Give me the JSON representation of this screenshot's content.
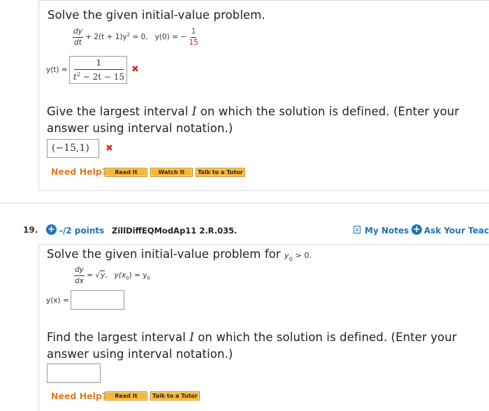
{
  "q18": {
    "title": "Solve the given initial-value problem.",
    "eq_dy": "dy",
    "eq_dt": "dt",
    "eq_rest": "+ 2(t + 1)y",
    "eq_sup": "2",
    "eq_zero": "= 0,",
    "eq_ic": "y(0) = −",
    "ic_num": "1",
    "ic_den": "15",
    "answer_label": "y(t) =",
    "answer_num": "1",
    "answer_den_t": "t",
    "answer_den_sup": "2",
    "answer_den_rest": "− 2t − 15",
    "interval_prompt": "Give the largest interval I on which the solution is defined. (Enter your answer using interval notation.)",
    "interval_prompt_pre": "Give the largest interval ",
    "interval_prompt_I": "I",
    "interval_prompt_post": " on which the solution is defined. (Enter your answer using interval notation.)",
    "interval_answer": "(−15,1)",
    "need_help": "Need Help?",
    "btn_read": "Read It",
    "btn_watch": "Watch It",
    "btn_tutor": "Talk to a Tutor"
  },
  "q19": {
    "number": "19.",
    "points": "-/2 points",
    "code": "ZillDiffEQModAp11 2.R.035.",
    "my_notes": "My Notes",
    "ask_teacher": "Ask Your Teacher",
    "title_pre": "Solve the given initial-value problem for ",
    "title_y0": "y",
    "title_sub": "0",
    "title_post": " > 0.",
    "eq_dy": "dy",
    "eq_dx": "dx",
    "eq_equals": "=",
    "eq_sqrt": "y",
    "eq_comma": ",",
    "eq_ic_pre": "y(x",
    "eq_ic_sub": "0",
    "eq_ic_mid": ") = y",
    "eq_ic_sub2": "0",
    "answer_label": "y(x) =",
    "answer_value": "",
    "interval_prompt_pre": "Find the largest interval ",
    "interval_prompt_I": "I",
    "interval_prompt_post": " on which the solution is defined. (Enter your answer using interval notation.)",
    "interval_answer": "",
    "need_help": "Need Help?",
    "btn_read": "Read It",
    "btn_tutor": "Talk to a Tutor"
  },
  "icons": {
    "wrong": "x-mark-icon",
    "plus": "plus-circle-icon",
    "notes": "notes-icon"
  },
  "colors": {
    "accent_blue": "#1f73b7",
    "error_red": "#d0302b",
    "help_orange": "#e07a1f",
    "button_gold": "#f7b733"
  }
}
